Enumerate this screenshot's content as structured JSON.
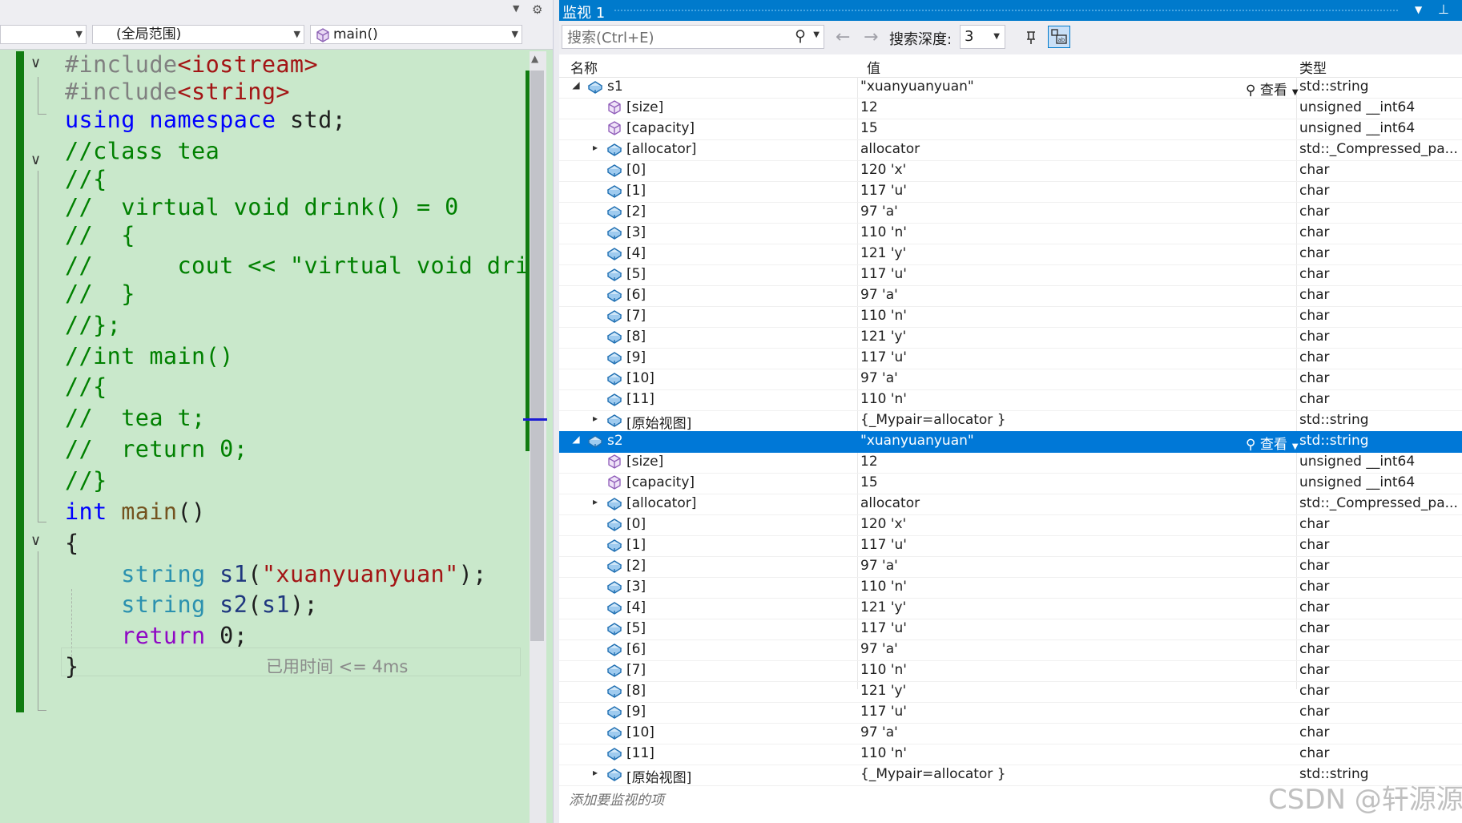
{
  "editor": {
    "scope_dropdown": "(全局范围)",
    "function_dropdown": "main()",
    "perf_tip": "已用时间 <= 4ms",
    "lines": [
      [
        {
          "c": "c-dir",
          "t": "#include"
        },
        {
          "c": "c-inc",
          "t": "<iostream>"
        }
      ],
      [
        {
          "c": "c-dir",
          "t": "#include"
        },
        {
          "c": "c-inc",
          "t": "<string>"
        }
      ],
      [
        {
          "c": "c-kw",
          "t": "using"
        },
        {
          "c": "c-pl",
          "t": " "
        },
        {
          "c": "c-kw",
          "t": "namespace"
        },
        {
          "c": "c-pl",
          "t": " std;"
        }
      ],
      [
        {
          "c": "c-cm",
          "t": "//class tea"
        }
      ],
      [
        {
          "c": "c-cm",
          "t": "//{"
        }
      ],
      [
        {
          "c": "c-cm",
          "t": "//  virtual void drink() = 0"
        }
      ],
      [
        {
          "c": "c-cm",
          "t": "//  {"
        }
      ],
      [
        {
          "c": "c-cm",
          "t": "//      cout << \"virtual void dri"
        }
      ],
      [
        {
          "c": "c-cm",
          "t": "//  }"
        }
      ],
      [
        {
          "c": "c-cm",
          "t": "//};"
        }
      ],
      [
        {
          "c": "c-cm",
          "t": "//int main()"
        }
      ],
      [
        {
          "c": "c-cm",
          "t": "//{"
        }
      ],
      [
        {
          "c": "c-cm",
          "t": "//  tea t;"
        }
      ],
      [
        {
          "c": "c-cm",
          "t": "//  return 0;"
        }
      ],
      [
        {
          "c": "c-cm",
          "t": "//}"
        }
      ],
      [
        {
          "c": "c-kw",
          "t": "int"
        },
        {
          "c": "c-pl",
          "t": " "
        },
        {
          "c": "c-fn",
          "t": "main"
        },
        {
          "c": "c-pl",
          "t": "()"
        }
      ],
      [
        {
          "c": "c-pl",
          "t": "{"
        }
      ],
      [
        {
          "c": "c-pl",
          "t": "    "
        },
        {
          "c": "c-type",
          "t": "string"
        },
        {
          "c": "c-pl",
          "t": " "
        },
        {
          "c": "c-id",
          "t": "s1"
        },
        {
          "c": "c-pl",
          "t": "("
        },
        {
          "c": "c-str",
          "t": "\"xuanyuanyuan\""
        },
        {
          "c": "c-pl",
          "t": ");"
        }
      ],
      [
        {
          "c": "c-pl",
          "t": "    "
        },
        {
          "c": "c-type",
          "t": "string"
        },
        {
          "c": "c-pl",
          "t": " "
        },
        {
          "c": "c-id",
          "t": "s2"
        },
        {
          "c": "c-pl",
          "t": "("
        },
        {
          "c": "c-id",
          "t": "s1"
        },
        {
          "c": "c-pl",
          "t": ");"
        }
      ],
      [
        {
          "c": "c-pl",
          "t": "    "
        },
        {
          "c": "c-ctrl",
          "t": "return"
        },
        {
          "c": "c-pl",
          "t": " 0;"
        }
      ],
      [
        {
          "c": "c-pl",
          "t": "}"
        }
      ]
    ]
  },
  "watch": {
    "title": "监视 1",
    "search_placeholder": "搜索(Ctrl+E)",
    "depth_label": "搜索深度:",
    "depth_value": "3",
    "columns": {
      "name": "名称",
      "value": "值",
      "type": "类型"
    },
    "view_label": "查看",
    "add_item": "添加要监视的项",
    "rows": [
      {
        "level": 0,
        "exp": "down",
        "icon": "var",
        "name": "s1",
        "value": "\"xuanyuanyuan\"",
        "type": "std::string",
        "view": true
      },
      {
        "level": 1,
        "exp": "",
        "icon": "prop",
        "name": "[size]",
        "value": "12",
        "type": "unsigned __int64"
      },
      {
        "level": 1,
        "exp": "",
        "icon": "prop",
        "name": "[capacity]",
        "value": "15",
        "type": "unsigned __int64"
      },
      {
        "level": 1,
        "exp": "right",
        "icon": "var",
        "name": "[allocator]",
        "value": "allocator",
        "type": "std::_Compressed_pa..."
      },
      {
        "level": 1,
        "exp": "",
        "icon": "var",
        "name": "[0]",
        "value": "120 'x'",
        "type": "char"
      },
      {
        "level": 1,
        "exp": "",
        "icon": "var",
        "name": "[1]",
        "value": "117 'u'",
        "type": "char"
      },
      {
        "level": 1,
        "exp": "",
        "icon": "var",
        "name": "[2]",
        "value": "97 'a'",
        "type": "char"
      },
      {
        "level": 1,
        "exp": "",
        "icon": "var",
        "name": "[3]",
        "value": "110 'n'",
        "type": "char"
      },
      {
        "level": 1,
        "exp": "",
        "icon": "var",
        "name": "[4]",
        "value": "121 'y'",
        "type": "char"
      },
      {
        "level": 1,
        "exp": "",
        "icon": "var",
        "name": "[5]",
        "value": "117 'u'",
        "type": "char"
      },
      {
        "level": 1,
        "exp": "",
        "icon": "var",
        "name": "[6]",
        "value": "97 'a'",
        "type": "char"
      },
      {
        "level": 1,
        "exp": "",
        "icon": "var",
        "name": "[7]",
        "value": "110 'n'",
        "type": "char"
      },
      {
        "level": 1,
        "exp": "",
        "icon": "var",
        "name": "[8]",
        "value": "121 'y'",
        "type": "char"
      },
      {
        "level": 1,
        "exp": "",
        "icon": "var",
        "name": "[9]",
        "value": "117 'u'",
        "type": "char"
      },
      {
        "level": 1,
        "exp": "",
        "icon": "var",
        "name": "[10]",
        "value": "97 'a'",
        "type": "char"
      },
      {
        "level": 1,
        "exp": "",
        "icon": "var",
        "name": "[11]",
        "value": "110 'n'",
        "type": "char"
      },
      {
        "level": 1,
        "exp": "right",
        "icon": "var",
        "name": "[原始视图]",
        "value": "{_Mypair=allocator }",
        "type": "std::string"
      },
      {
        "level": 0,
        "exp": "down",
        "icon": "var",
        "name": "s2",
        "value": "\"xuanyuanyuan\"",
        "type": "std::string",
        "view": true,
        "selected": true
      },
      {
        "level": 1,
        "exp": "",
        "icon": "prop",
        "name": "[size]",
        "value": "12",
        "type": "unsigned __int64"
      },
      {
        "level": 1,
        "exp": "",
        "icon": "prop",
        "name": "[capacity]",
        "value": "15",
        "type": "unsigned __int64"
      },
      {
        "level": 1,
        "exp": "right",
        "icon": "var",
        "name": "[allocator]",
        "value": "allocator",
        "type": "std::_Compressed_pa..."
      },
      {
        "level": 1,
        "exp": "",
        "icon": "var",
        "name": "[0]",
        "value": "120 'x'",
        "type": "char"
      },
      {
        "level": 1,
        "exp": "",
        "icon": "var",
        "name": "[1]",
        "value": "117 'u'",
        "type": "char"
      },
      {
        "level": 1,
        "exp": "",
        "icon": "var",
        "name": "[2]",
        "value": "97 'a'",
        "type": "char"
      },
      {
        "level": 1,
        "exp": "",
        "icon": "var",
        "name": "[3]",
        "value": "110 'n'",
        "type": "char"
      },
      {
        "level": 1,
        "exp": "",
        "icon": "var",
        "name": "[4]",
        "value": "121 'y'",
        "type": "char"
      },
      {
        "level": 1,
        "exp": "",
        "icon": "var",
        "name": "[5]",
        "value": "117 'u'",
        "type": "char"
      },
      {
        "level": 1,
        "exp": "",
        "icon": "var",
        "name": "[6]",
        "value": "97 'a'",
        "type": "char"
      },
      {
        "level": 1,
        "exp": "",
        "icon": "var",
        "name": "[7]",
        "value": "110 'n'",
        "type": "char"
      },
      {
        "level": 1,
        "exp": "",
        "icon": "var",
        "name": "[8]",
        "value": "121 'y'",
        "type": "char"
      },
      {
        "level": 1,
        "exp": "",
        "icon": "var",
        "name": "[9]",
        "value": "117 'u'",
        "type": "char"
      },
      {
        "level": 1,
        "exp": "",
        "icon": "var",
        "name": "[10]",
        "value": "97 'a'",
        "type": "char"
      },
      {
        "level": 1,
        "exp": "",
        "icon": "var",
        "name": "[11]",
        "value": "110 'n'",
        "type": "char"
      },
      {
        "level": 1,
        "exp": "right",
        "icon": "var",
        "name": "[原始视图]",
        "value": "{_Mypair=allocator }",
        "type": "std::string"
      }
    ]
  },
  "watermark": "CSDN @轩源源",
  "colors": {
    "accent": "#007acc",
    "selection": "#0078d7",
    "editor_bg": "#c9e8cb",
    "change_bar": "#107c10"
  }
}
